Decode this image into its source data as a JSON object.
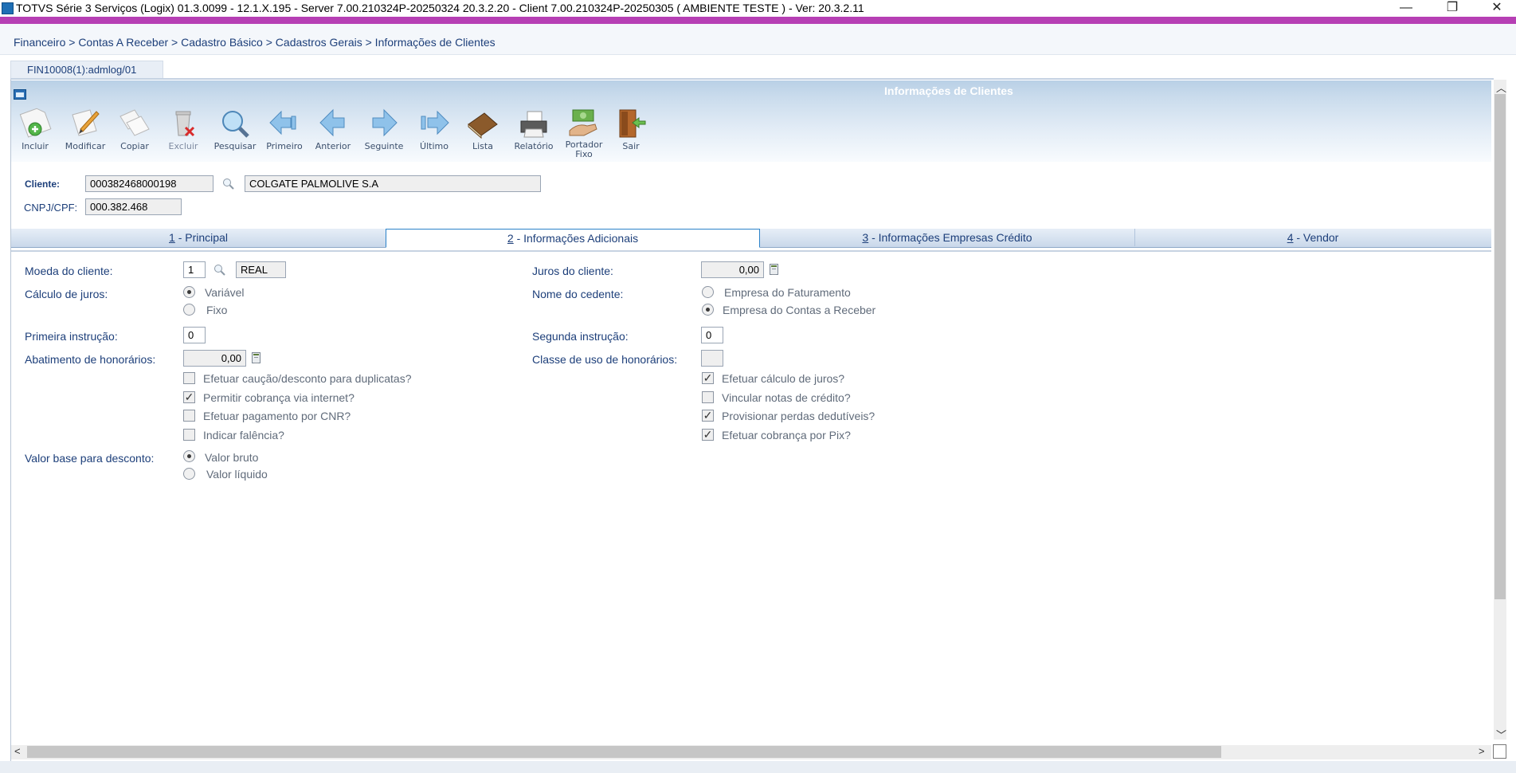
{
  "window": {
    "title": "TOTVS Série 3 Serviços (Logix) 01.3.0099  -  12.1.X.195 - Server 7.00.210324P-20250324 20.3.2.20 - Client 7.00.210324P-20250305     ( AMBIENTE TESTE )  - Ver: 20.3.2.11",
    "minimize": "—",
    "restore": "❐",
    "close": "✕"
  },
  "breadcrumb": "Financeiro > Contas A Receber > Cadastro Básico > Cadastros Gerais > Informações de Clientes",
  "program_tab": "FIN10008(1):admlog/01",
  "form_title": "Informações de Clientes",
  "toolbar": {
    "incluir": "Incluir",
    "modificar": "Modificar",
    "copiar": "Copiar",
    "excluir": "Excluir",
    "pesquisar": "Pesquisar",
    "primeiro": "Primeiro",
    "anterior": "Anterior",
    "seguinte": "Seguinte",
    "ultimo": "Último",
    "lista": "Lista",
    "relatorio": "Relatório",
    "portador_fixo_1": "Portador",
    "portador_fixo_2": "Fixo",
    "sair": "Sair"
  },
  "header": {
    "cliente_label": "Cliente:",
    "cliente_code": "000382468000198",
    "cliente_name": "COLGATE PALMOLIVE S.A",
    "cnpj_label": "CNPJ/CPF:",
    "cnpj_value": "000.382.468"
  },
  "tabs": [
    {
      "num": "1",
      "label": " - Principal"
    },
    {
      "num": "2",
      "label": " - Informações Adicionais"
    },
    {
      "num": "3",
      "label": " - Informações Empresas Crédito"
    },
    {
      "num": "4",
      "label": " - Vendor"
    }
  ],
  "form": {
    "moeda_label": "Moeda do cliente:",
    "moeda_code": "1",
    "moeda_name": "REAL",
    "juros_label": "Juros do cliente:",
    "juros_value": "0,00",
    "calculo_label": "Cálculo de  juros:",
    "calculo_options": [
      "Variável",
      "Fixo"
    ],
    "nome_cedente_label": "Nome do cedente:",
    "cedente_options": [
      "Empresa do Faturamento",
      "Empresa do Contas a Receber"
    ],
    "primeira_label": "Primeira instrução:",
    "primeira_value": "0",
    "segunda_label": "Segunda instrução:",
    "segunda_value": "0",
    "abatimento_label": "Abatimento de honorários:",
    "abatimento_value": "0,00",
    "classe_label": "Classe de uso de honorários:",
    "classe_value": "",
    "left_checks": [
      {
        "label": "Efetuar caução/desconto para duplicatas?",
        "checked": false
      },
      {
        "label": "Permitir cobrança via internet?",
        "checked": true
      },
      {
        "label": "Efetuar pagamento por CNR?",
        "checked": false
      },
      {
        "label": "Indicar falência?",
        "checked": false
      }
    ],
    "right_checks": [
      {
        "label": "Efetuar cálculo de juros?",
        "checked": true
      },
      {
        "label": "Vincular notas de crédito?",
        "checked": false
      },
      {
        "label": "Provisionar perdas dedutíveis?",
        "checked": true
      },
      {
        "label": "Efetuar cobrança por Pix?",
        "checked": true
      }
    ],
    "valor_base_label": "Valor base para desconto:",
    "valor_base_options": [
      "Valor bruto",
      "Valor líquido"
    ],
    "check_mark": "✓"
  },
  "colors": {
    "accent_purple": "#b63fb4",
    "label_blue": "#1d3f7a",
    "active_tab_border": "#2b82c9"
  }
}
